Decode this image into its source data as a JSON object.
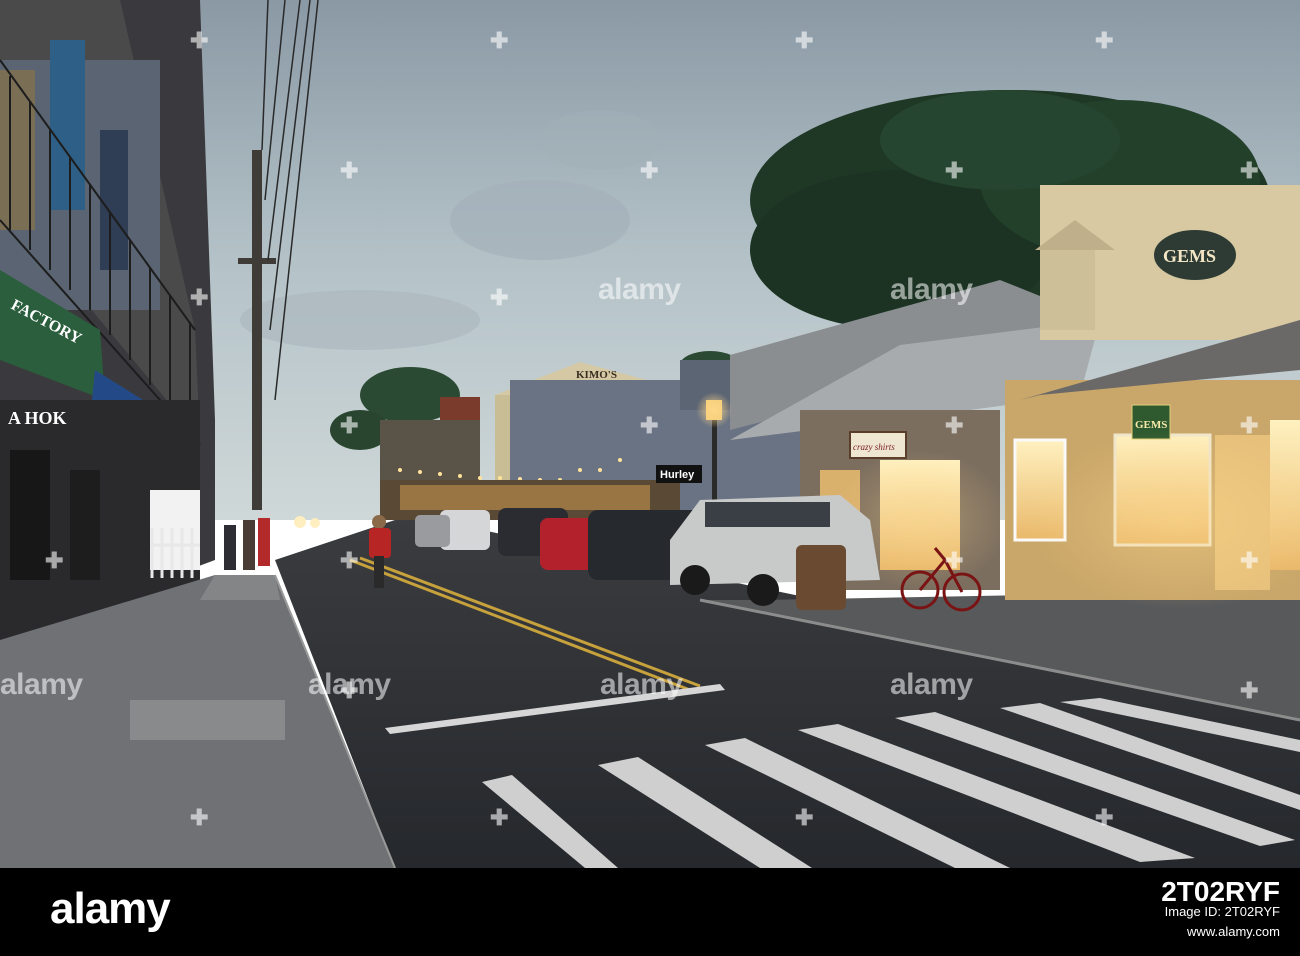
{
  "signs": {
    "kimos": "KIMO'S",
    "gems_top": "GEMS",
    "gems_small": "GEMS",
    "hurley": "Hurley",
    "crazy_shirts": "crazy shirts",
    "factory": "FACTORY",
    "hoku": "A HOK"
  },
  "watermark": {
    "word": "alamy"
  },
  "bottom_bar": {
    "logo": "alamy",
    "line1": "Image ID: 2T02RYF",
    "line2": "www.alamy.com",
    "image_id": "2T02RYF"
  },
  "colors": {
    "sky_top": "#8c9aa6",
    "sky_bottom": "#c8d4d6",
    "road": "#2d3035",
    "tree": "#1e3524",
    "shop_light": "#f3c46a",
    "bar": "#000000"
  }
}
